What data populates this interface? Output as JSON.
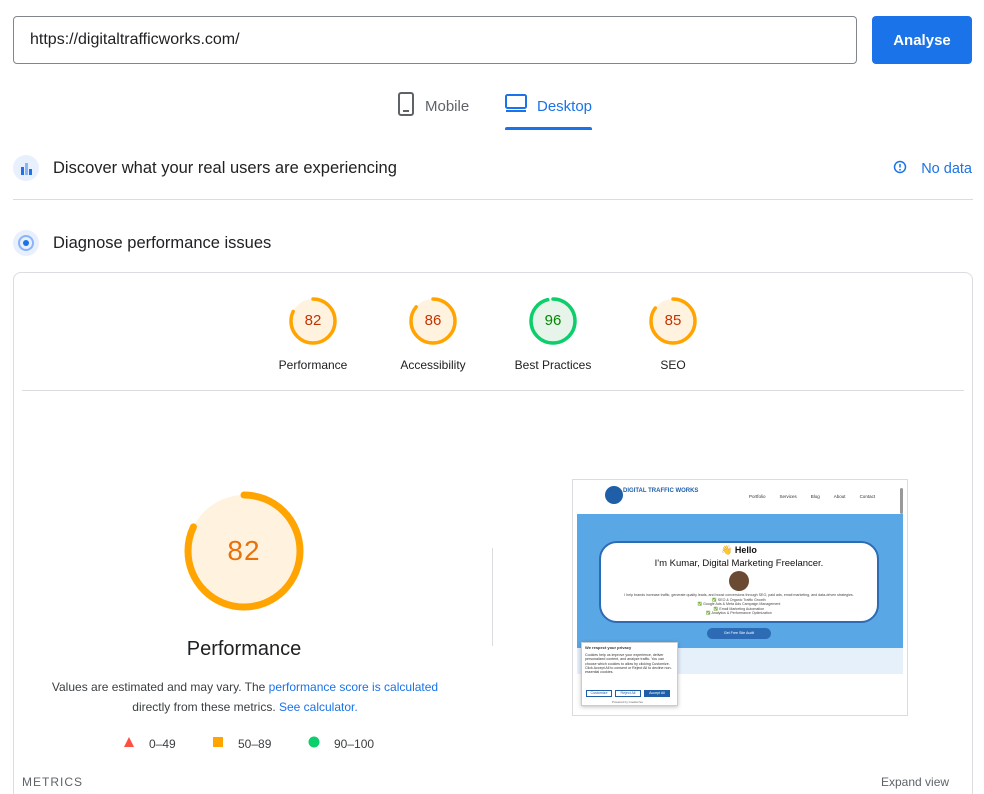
{
  "url_bar": {
    "value": "https://digitaltrafficworks.com/",
    "button_label": "Analyse"
  },
  "tabs": [
    {
      "label": "Mobile",
      "icon": "phone-icon",
      "active": false
    },
    {
      "label": "Desktop",
      "icon": "monitor-icon",
      "active": true
    }
  ],
  "field_data": {
    "title": "Discover what your real users are experiencing",
    "status": "No data",
    "icon": "users-icon"
  },
  "lab_data": {
    "title": "Diagnose performance issues",
    "icon": "diagnose-icon"
  },
  "categories": [
    {
      "label": "Performance",
      "score": 82,
      "color": "#e8710a"
    },
    {
      "label": "Accessibility",
      "score": 86,
      "color": "#e8710a"
    },
    {
      "label": "Best Practices",
      "score": 96,
      "color": "#0cce6b"
    },
    {
      "label": "SEO",
      "score": 85,
      "color": "#e8710a"
    }
  ],
  "performance": {
    "score": "82",
    "title": "Performance",
    "note_prefix": "Values are estimated and may vary. The ",
    "note_link": "performance score is calculated",
    "note_mid": "directly from these metrics. ",
    "note_link2": "See calculator."
  },
  "legend": [
    {
      "range": "0–49",
      "shape": "triangle",
      "color": "#ff4e42"
    },
    {
      "range": "50–89",
      "shape": "square",
      "color": "#ffa400"
    },
    {
      "range": "90–100",
      "shape": "circle",
      "color": "#0cce6b"
    }
  ],
  "metrics_label": "METRICS",
  "expand_label": "Expand view",
  "screenshot": {
    "logo": "DIGITAL TRAFFIC WORKS",
    "nav": [
      "Portfolio",
      "Services",
      "Blog",
      "About",
      "Contact"
    ],
    "hello": "👋 Hello",
    "headline": "I'm Kumar, Digital Marketing Freelancer.",
    "body": "I help brands increase traffic, generate quality leads, and boost conversions through SEO, paid ads, email marketing, and data-driven strategies.",
    "bullets": [
      "✅ SEO & Organic Traffic Growth",
      "✅ Google Ads & Meta Ads Campaign Management",
      "✅ Email Marketing Automation",
      "✅ Analytics & Performance Optimization"
    ],
    "cta": "Get Free Site Audit",
    "cookie_title": "We respect your privacy",
    "cookie_body": "Cookies help us improve your experience, deliver personalized content, and analyze traffic. You can choose which cookies to allow by clicking Customize. Click Accept All to consent or Reject All to decline non-essential cookies.",
    "cookie_buttons": [
      "Customize",
      "Reject All",
      "Accept All"
    ],
    "cookie_footer": "Powered by CookieYes"
  }
}
